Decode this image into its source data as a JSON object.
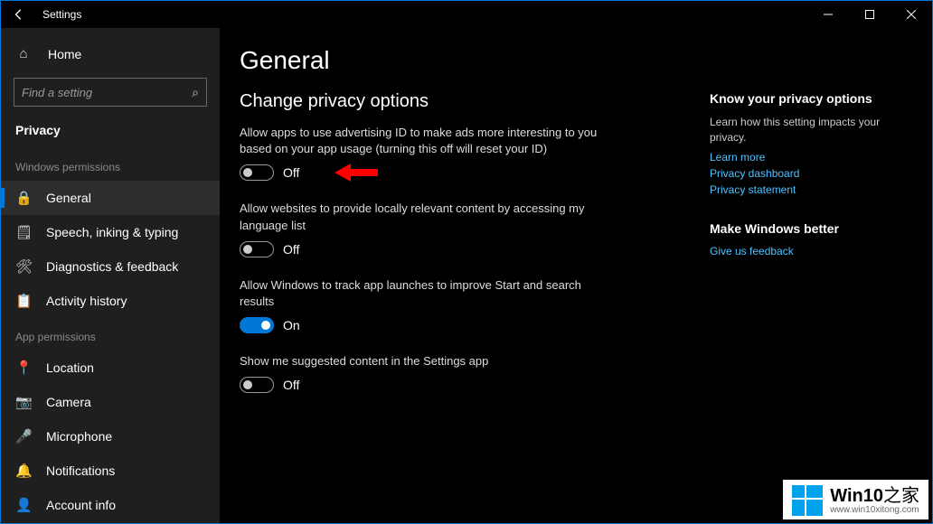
{
  "titlebar": {
    "app_name": "Settings"
  },
  "sidebar": {
    "home": "Home",
    "search_placeholder": "Find a setting",
    "category": "Privacy",
    "sections": [
      {
        "label": "Windows permissions",
        "items": [
          {
            "id": "general",
            "icon": "🔒",
            "label": "General",
            "selected": true
          },
          {
            "id": "speech",
            "icon": "🗒",
            "label": "Speech, inking & typing",
            "selected": false
          },
          {
            "id": "diagnostics",
            "icon": "🛠",
            "label": "Diagnostics & feedback",
            "selected": false
          },
          {
            "id": "activity-history",
            "icon": "📋",
            "label": "Activity history",
            "selected": false
          }
        ]
      },
      {
        "label": "App permissions",
        "items": [
          {
            "id": "location",
            "icon": "📍",
            "label": "Location",
            "selected": false
          },
          {
            "id": "camera",
            "icon": "📷",
            "label": "Camera",
            "selected": false
          },
          {
            "id": "microphone",
            "icon": "🎤",
            "label": "Microphone",
            "selected": false
          },
          {
            "id": "notifications",
            "icon": "🔔",
            "label": "Notifications",
            "selected": false
          },
          {
            "id": "account-info",
            "icon": "👤",
            "label": "Account info",
            "selected": false
          }
        ]
      }
    ]
  },
  "main": {
    "title": "General",
    "subtitle": "Change privacy options",
    "settings": [
      {
        "id": "advertising-id",
        "desc": "Allow apps to use advertising ID to make ads more interesting to you based on your app usage (turning this off will reset your ID)",
        "state": "Off",
        "on": false,
        "arrow": true
      },
      {
        "id": "language-list",
        "desc": "Allow websites to provide locally relevant content by accessing my language list",
        "state": "Off",
        "on": false,
        "arrow": false
      },
      {
        "id": "track-launches",
        "desc": "Allow Windows to track app launches to improve Start and search results",
        "state": "On",
        "on": true,
        "arrow": false
      },
      {
        "id": "suggested-content",
        "desc": "Show me suggested content in the Settings app",
        "state": "Off",
        "on": false,
        "arrow": false
      }
    ]
  },
  "aside": {
    "blocks": [
      {
        "title": "Know your privacy options",
        "text": "Learn how this setting impacts your privacy.",
        "links": [
          "Learn more",
          "Privacy dashboard",
          "Privacy statement"
        ]
      },
      {
        "title": "Make Windows better",
        "text": "",
        "links": [
          "Give us feedback"
        ]
      }
    ]
  },
  "watermark": {
    "brand": "Win10",
    "suffix": "之家",
    "url": "www.win10xitong.com"
  }
}
